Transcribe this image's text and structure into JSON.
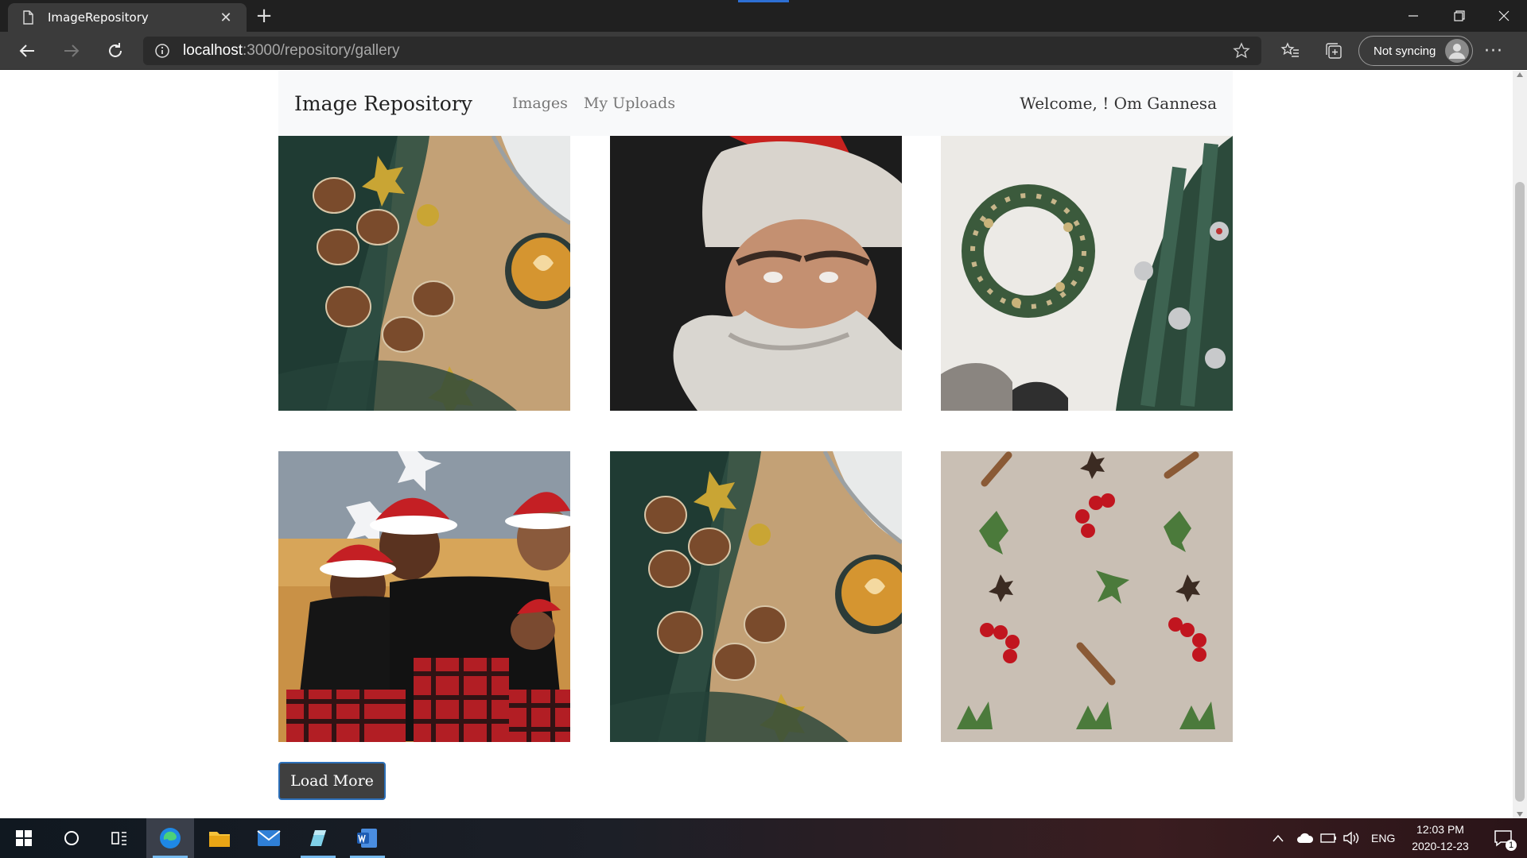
{
  "browser": {
    "tab_title": "ImageRepository",
    "url_host": "localhost",
    "url_path": ":3000/repository/gallery",
    "sync_label": "Not syncing",
    "more_label": "···"
  },
  "site": {
    "brand": "Image Repository",
    "nav": [
      "Images",
      "My Uploads"
    ],
    "welcome": "Welcome, ! Om Gannesa",
    "load_more": "Load More"
  },
  "gallery": [
    {
      "subject": "pinecones, bows and coffee cup on wood"
    },
    {
      "subject": "man in santa hat and beard"
    },
    {
      "subject": "wreath and christmas tree"
    },
    {
      "subject": "family in santa hats"
    },
    {
      "subject": "pinecones, bows and coffee cup on wood"
    },
    {
      "subject": "berries, cinnamon and greenery flatlay"
    }
  ],
  "taskbar": {
    "language": "ENG",
    "time": "12:03 PM",
    "date": "2020-12-23",
    "notification_count": "1"
  },
  "colors": {
    "chrome_dark": "#202020",
    "toolbar": "#3b3b3b",
    "navbar_bg": "#f8f9fa",
    "button_border": "#2c6fb8"
  }
}
